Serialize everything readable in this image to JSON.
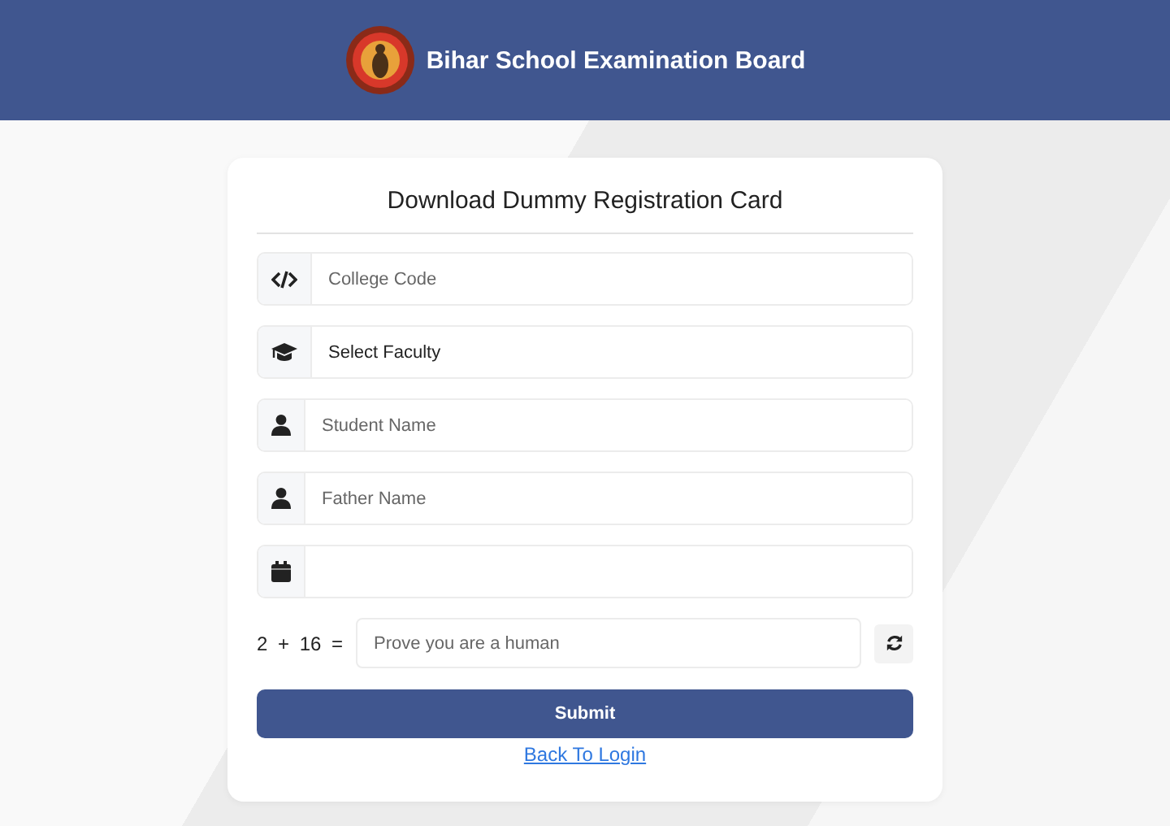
{
  "header": {
    "title": "Bihar School Examination Board"
  },
  "card": {
    "title": "Download Dummy Registration Card",
    "fields": [
      {
        "kind": "text",
        "placeholder": "College Code"
      },
      {
        "kind": "select",
        "value": "Select Faculty"
      },
      {
        "kind": "text",
        "placeholder": "Student Name"
      },
      {
        "kind": "text",
        "placeholder": "Father Name"
      },
      {
        "kind": "date"
      }
    ],
    "captcha": {
      "question": "2 + 16 =",
      "placeholder": "Prove you are a human"
    },
    "submit": "Submit",
    "link": "Back To Login"
  }
}
